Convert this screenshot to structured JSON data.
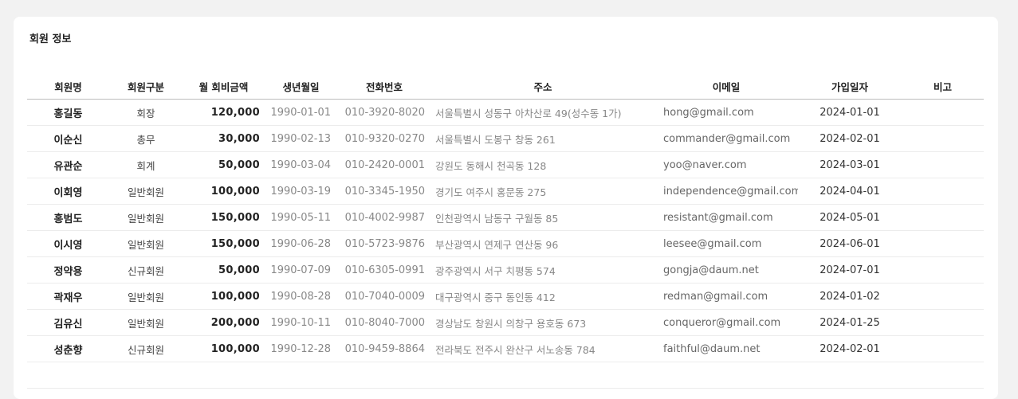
{
  "section": {
    "title": "회원 정보"
  },
  "table": {
    "headers": [
      "회원명",
      "회원구분",
      "월 회비금액",
      "생년월일",
      "전화번호",
      "주소",
      "이메일",
      "가입일자",
      "비고"
    ],
    "rows": [
      [
        "홍길동",
        "회장",
        "120,000",
        "1990-01-01",
        "010-3920-8020",
        "서울특별시 성동구 아차산로 49(성수동 1가)",
        "hong@gmail.com",
        "2024-01-01",
        ""
      ],
      [
        "이순신",
        "총무",
        "30,000",
        "1990-02-13",
        "010-9320-0270",
        "서울특별시 도봉구 창동 261",
        "commander@gmail.com",
        "2024-02-01",
        ""
      ],
      [
        "유관순",
        "회계",
        "50,000",
        "1990-03-04",
        "010-2420-0001",
        "강원도 동해시 천곡동 128",
        "yoo@naver.com",
        "2024-03-01",
        ""
      ],
      [
        "이회영",
        "일반회원",
        "100,000",
        "1990-03-19",
        "010-3345-1950",
        "경기도 여주시 홍문동 275",
        "independence@gmail.com",
        "2024-04-01",
        ""
      ],
      [
        "홍범도",
        "일반회원",
        "150,000",
        "1990-05-11",
        "010-4002-9987",
        "인천광역시 남동구 구월동 85",
        "resistant@gmail.com",
        "2024-05-01",
        ""
      ],
      [
        "이시영",
        "일반회원",
        "150,000",
        "1990-06-28",
        "010-5723-9876",
        "부산광역시 연제구 연산동 96",
        "leesee@gmail.com",
        "2024-06-01",
        ""
      ],
      [
        "정약용",
        "신규회원",
        "50,000",
        "1990-07-09",
        "010-6305-0991",
        "광주광역시 서구 치평동 574",
        "gongja@daum.net",
        "2024-07-01",
        ""
      ],
      [
        "곽재우",
        "일반회원",
        "100,000",
        "1990-08-28",
        "010-7040-0009",
        "대구광역시 중구 동인동 412",
        "redman@gmail.com",
        "2024-01-02",
        ""
      ],
      [
        "김유신",
        "일반회원",
        "200,000",
        "1990-10-11",
        "010-8040-7000",
        "경상남도 창원시 의창구 용호동 673",
        "conqueror@gmail.com",
        "2024-01-25",
        ""
      ],
      [
        "성춘향",
        "신규회원",
        "100,000",
        "1990-12-28",
        "010-9459-8864",
        "전라북도 전주시 완산구 서노송동 784",
        "faithful@daum.net",
        "2024-02-01",
        ""
      ]
    ]
  }
}
